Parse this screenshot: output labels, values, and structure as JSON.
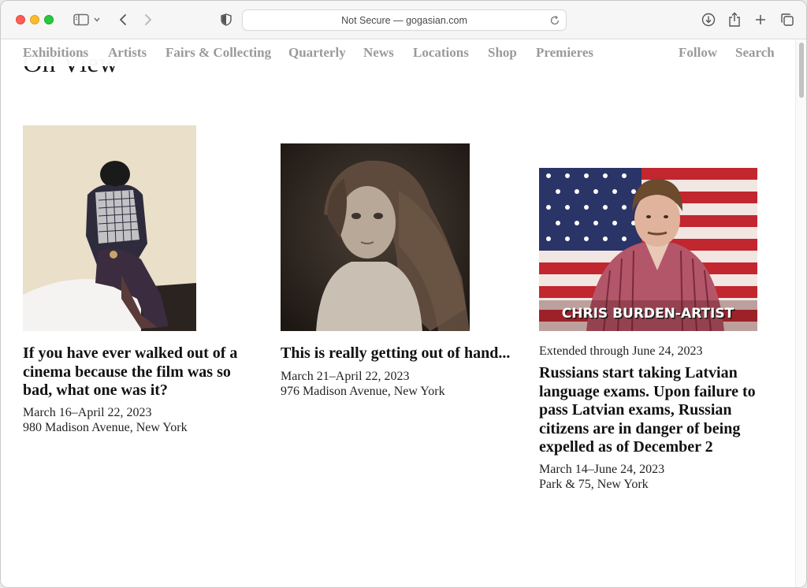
{
  "browser": {
    "address": "Not Secure — gogasian.com"
  },
  "nav": {
    "items": [
      "Exhibitions",
      "Artists",
      "Fairs & Collecting",
      "Quarterly",
      "News",
      "Locations",
      "Shop",
      "Premieres"
    ],
    "follow": "Follow",
    "search": "Search"
  },
  "section": {
    "title": "On View"
  },
  "cards": [
    {
      "title": "If you have ever walked out of a cinema because the film was so bad, what one was it?",
      "dates": "March 16–April 22, 2023",
      "location": "980 Madison Avenue, New York"
    },
    {
      "title": "This is really getting out of hand...",
      "dates": "March 21–April 22, 2023",
      "location": "976 Madison Avenue, New York"
    },
    {
      "pre": "Extended through June 24, 2023",
      "title": "Russians start taking Latvian language exams. Upon failure to pass Latvian exams, Russian citizens are in danger of being expelled as of December 2",
      "dates": "March 14–June 24, 2023",
      "location": "Park & 75, New York",
      "image_caption": "CHRIS BURDEN-ARTIST"
    }
  ],
  "icons": {
    "sidebar": "sidebar-icon",
    "back": "chevron-left-icon",
    "forward": "chevron-right-icon",
    "privacy": "shield-icon",
    "reload": "reload-icon",
    "download": "download-icon",
    "share": "share-icon",
    "new_tab": "plus-icon",
    "tabs": "tabs-overview-icon"
  }
}
